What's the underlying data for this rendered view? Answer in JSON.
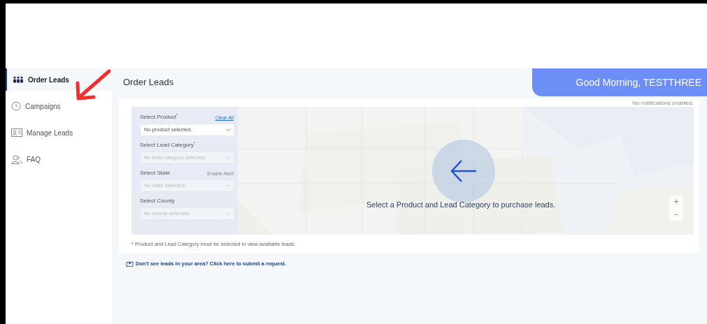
{
  "sidebar": {
    "items": [
      {
        "label": "Order Leads",
        "selected": true
      },
      {
        "label": "Campaigns",
        "selected": false
      },
      {
        "label": "Manage Leads",
        "selected": false
      },
      {
        "label": "FAQ",
        "selected": false
      }
    ]
  },
  "page_title": "Order Leads",
  "greeting": "Good Morning, TESTTHREE",
  "notifications": "No notifications enabled.",
  "form": {
    "clear_all": "Clear All",
    "enable_alert": "Enable Alert",
    "fields": [
      {
        "label": "Select Product",
        "required_mark": "*",
        "placeholder": "No product selected.",
        "disabled": false
      },
      {
        "label": "Select Lead Category",
        "required_mark": "*",
        "placeholder": "No lead category selected.",
        "disabled": true
      },
      {
        "label": "Select State",
        "placeholder": "No state selected.",
        "disabled": true
      },
      {
        "label": "Select County",
        "placeholder": "No county selected.",
        "disabled": true
      }
    ]
  },
  "map": {
    "prompt": "Select a Product and Lead Category to purchase leads.",
    "zoom_in": "+",
    "zoom_out": "−"
  },
  "footnote": "* Product and Lead Category must be selected to view available leads.",
  "request_link": "Don't see leads in your area? Click here to submit a request."
}
